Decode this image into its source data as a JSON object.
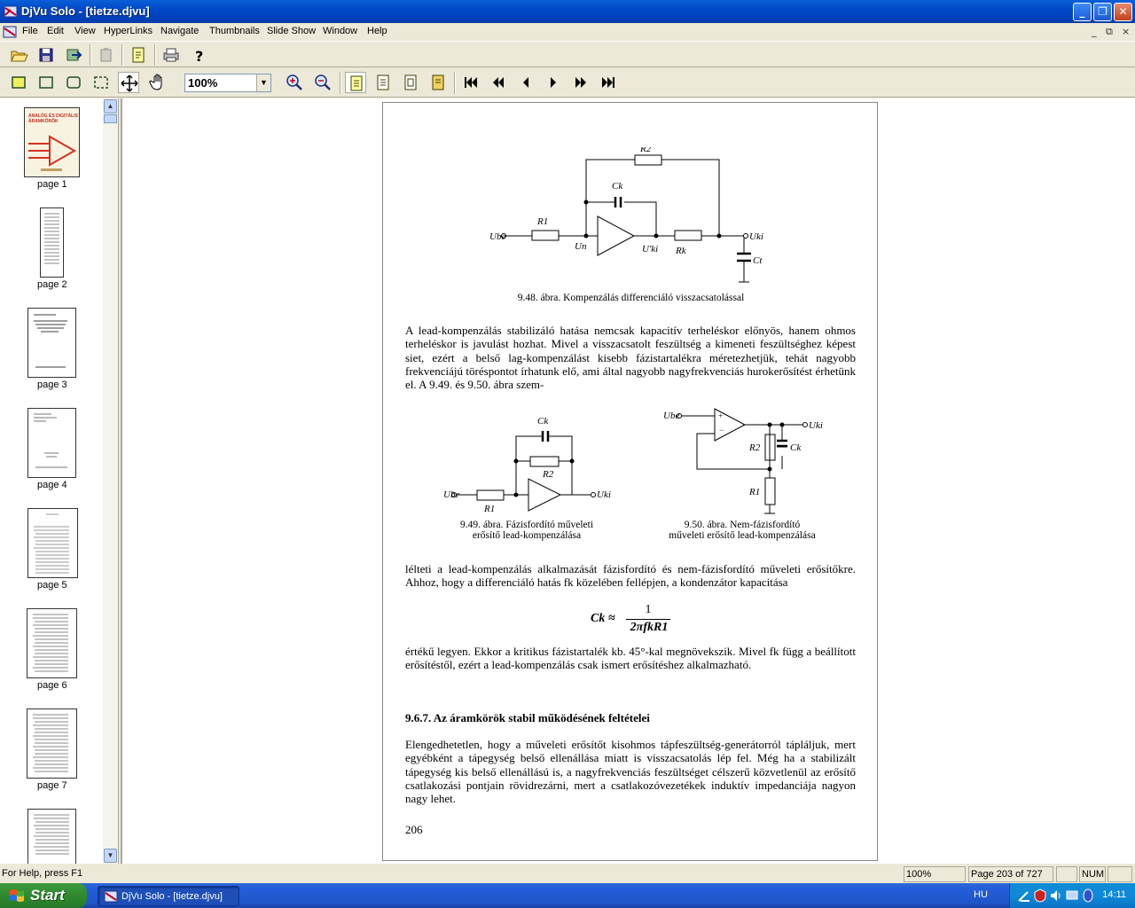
{
  "window": {
    "title": "DjVu Solo - [tietze.djvu]"
  },
  "menu": [
    "File",
    "Edit",
    "View",
    "HyperLinks",
    "Navigate",
    "Thumbnails",
    "Slide Show",
    "Window",
    "Help"
  ],
  "mdi_controls": [
    "_",
    "⧉",
    "×"
  ],
  "toolbar": {
    "zoom_value": "100%",
    "file_buttons": [
      "open-icon",
      "save-icon",
      "export-icon",
      "paste-icon",
      "document-icon",
      "print-icon",
      "help-icon"
    ],
    "nav_buttons": [
      "first-page-icon",
      "prev-group-icon",
      "prev-page-icon",
      "next-page-icon",
      "next-group-icon",
      "last-page-icon"
    ]
  },
  "thumbnails": [
    {
      "label": "page 1"
    },
    {
      "label": "page 2"
    },
    {
      "label": "page 3"
    },
    {
      "label": "page 4"
    },
    {
      "label": "page 5"
    },
    {
      "label": "page 6"
    },
    {
      "label": "page 7"
    }
  ],
  "thumbnail_cover": {
    "title_line1": "ANALÓG ÉS DIGITÁLIS",
    "title_line2": "ÁRAMKÖRÖK"
  },
  "document": {
    "fig_948": {
      "caption": "9.48. ábra. Kompenzálás differenciáló visszacsatolással",
      "labels": {
        "r2": "R2",
        "ck": "Ck",
        "r1": "R1",
        "ube": "Ube",
        "un": "Un",
        "uki_prime": "U'ki",
        "rk": "Rk",
        "uki": "Uki",
        "ct": "Ct"
      }
    },
    "para1": "A lead-kompenzálás stabilizáló hatása nemcsak kapacitív terheléskor előnyös, hanem ohmos terheléskor is javulást hozhat. Mivel a visszacsatolt feszültség a kimeneti feszültséghez képest siet, ezért a belső lag-kompenzálást kisebb fázistartalékra méretezhetjük, tehát nagyobb frekvenciájú töréspontot írhatunk elő, ami által nagyobb nagyfrekvenciás hurokerősítést érhetünk el. A 9.49. és 9.50. ábra szem-",
    "fig_949": {
      "caption_line1": "9.49. ábra. Fázisfordító műveleti",
      "caption_line2": "erősítő lead-kompenzálása",
      "labels": {
        "ck": "Ck",
        "r2": "R2",
        "ube": "Ube",
        "r1": "R1",
        "uki": "Uki"
      }
    },
    "fig_950": {
      "caption_line1": "9.50. ábra. Nem-fázisfordító",
      "caption_line2": "műveleti erősítő lead-kompenzálása",
      "labels": {
        "ube": "Ube",
        "uki": "Uki",
        "r2": "R2",
        "ck": "Ck",
        "r1": "R1"
      }
    },
    "para2": "lélteti a lead-kompenzálás alkalmazását fázisfordító és nem-fázisfordító műveleti erősítőkre. Ahhoz, hogy a differenciáló hatás fk közelében fellépjen, a kondenzátor kapacitása",
    "formula": {
      "lhs": "Ck ≈",
      "numerator": "1",
      "denominator": "2πfkR1"
    },
    "para3": "értékű legyen. Ekkor a kritikus fázistartalék kb. 45°-kal megnövekszik. Mivel fk függ a beállított erősítéstől, ezért a lead-kompenzálás csak ismert erősítéshez alkalmazható.",
    "heading": "9.6.7. Az áramkörök stabil működésének feltételei",
    "para4": "Elengedhetetlen, hogy a műveleti erősítőt kisohmos tápfeszültség-generátorról tápláljuk, mert egyébként a tápegység belső ellenállása miatt is visszacsatolás lép fel. Még ha a stabilizált tápegység kis belső ellenállású is, a nagyfrekvenciás feszültséget célszerű közvetlenül az erősítő csatlakozási pontjain rövidrezárni, mert a csatlakozóvezetékek induktív impedanciája nagyon nagy lehet.",
    "page_number": "206"
  },
  "status": {
    "help": "For Help, press F1",
    "zoom": "100%",
    "page": "Page 203 of 727",
    "num": "NUM"
  },
  "taskbar": {
    "start": "Start",
    "task": "DjVu Solo - [tietze.djvu]",
    "lang": "HU",
    "clock": "14:11"
  }
}
